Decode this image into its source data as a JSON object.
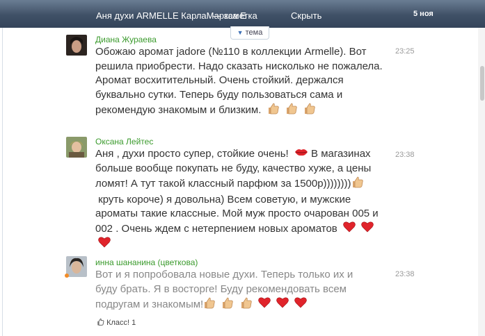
{
  "header": {
    "title": "Аня духи ARMELLE КарлаМаркса Е",
    "note_label": "— заметка",
    "hide_label": "Скрыть",
    "date": "5 ноя",
    "topic_label": "тема"
  },
  "messages": [
    {
      "author": "Диана Жураева",
      "time": "23:25",
      "lines": [
        "Обожаю аромат jadore (№110 в коллекции Armelle). Вот",
        "решила приобрести. Надо сказать нисколько не пожалела.",
        "Аромат восхитительный. Очень стойкий. держался",
        "буквально сутки. Теперь буду пользоваться сама и",
        "рекомендую знакомым и близким."
      ],
      "emoji": [
        "thumbs-up-icon",
        "thumbs-up-icon",
        "thumbs-up-icon"
      ]
    },
    {
      "author": "Оксана Лейтес",
      "time": "23:38",
      "lines": [
        "Аня , духи просто супер, стойкие очень!",
        "В магазинах",
        "больше вообще покупать не буду, качество хуже, а цены",
        "ломят! А тут такой классный парфюм за 1500р))))))))",
        " круть короче) я довольна) Всем советую, и мужские",
        "ароматы такие классные. Мой муж просто очарован 005 и",
        "002 . Очень ждем с нетерпением новых ароматов"
      ]
    },
    {
      "author": "инна шананина (цветкова)",
      "time": "23:38",
      "lines": [
        "Вот и я попробовала новые духи. Теперь только их и",
        "буду брать. Я в восторге! Буду рекомендовать всем",
        "подругам и знакомым!"
      ],
      "like_label": "Класс!",
      "like_count": "1"
    }
  ],
  "colors": {
    "author": "#3a9a2c",
    "heart": "#e0242b",
    "thumb": "#e8b87a",
    "online": "#f28c28"
  }
}
